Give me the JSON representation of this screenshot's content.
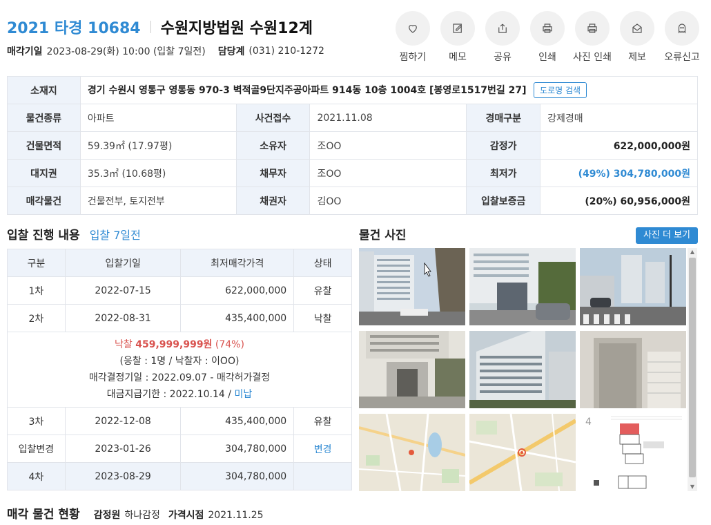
{
  "header": {
    "case_no": "2021 타경 10684",
    "court": "수원지방법원 수원12계",
    "sale_date_label": "매각기일",
    "sale_date": "2023-08-29(화) 10:00 (입찰 7일전)",
    "contact_label": "담당계",
    "contact": "(031) 210-1272"
  },
  "actions": [
    {
      "label": "찜하기",
      "icon": "heart-icon"
    },
    {
      "label": "메모",
      "icon": "memo-icon"
    },
    {
      "label": "공유",
      "icon": "share-icon"
    },
    {
      "label": "인쇄",
      "icon": "print-icon"
    },
    {
      "label": "사진 인쇄",
      "icon": "photo-print-icon"
    },
    {
      "label": "제보",
      "icon": "mail-icon"
    },
    {
      "label": "오류신고",
      "icon": "ghost-icon"
    }
  ],
  "info": {
    "location_label": "소재지",
    "location": "경기 수원시 영통구 영통동 970-3 벽적골9단지주공아파트 914동 10층 1004호 [봉영로1517번길 27]",
    "road_btn": "도로명 검색",
    "type_label": "물건종류",
    "type": "아파트",
    "received_label": "사건접수",
    "received": "2021.11.08",
    "auction_kind_label": "경매구분",
    "auction_kind": "강제경매",
    "area_label": "건물면적",
    "area": "59.39㎡ (17.97평)",
    "owner_label": "소유자",
    "owner": "조OO",
    "appraisal_label": "감정가",
    "appraisal": "622,000,000원",
    "land_label": "대지권",
    "land": "35.3㎡ (10.68평)",
    "debtor_label": "채무자",
    "debtor": "조OO",
    "min_price_label": "최저가",
    "min_price": "(49%) 304,780,000원",
    "items_label": "매각물건",
    "items": "건물전부, 토지전부",
    "creditor_label": "채권자",
    "creditor": "김OO",
    "deposit_label": "입찰보증금",
    "deposit": "(20%) 60,956,000원"
  },
  "bids": {
    "title": "입찰 진행 내용",
    "subtitle": "입찰 7일전",
    "headers": [
      "구분",
      "입찰기일",
      "최저매각가격",
      "상태"
    ],
    "rows": [
      {
        "round": "1차",
        "date": "2022-07-15",
        "price": "622,000,000",
        "status": "유찰"
      },
      {
        "round": "2차",
        "date": "2022-08-31",
        "price": "435,400,000",
        "status": "낙찰"
      }
    ],
    "detail": {
      "won_label": "낙찰",
      "won_amount": "459,999,999원",
      "won_pct": "(74%)",
      "line2": "(응찰 : 1명 / 낙찰자 : 이OO)",
      "line3": "매각결정기일 : 2022.09.07 - 매각허가결정",
      "line4": "대금지급기한 : 2022.10.14 /",
      "line4_status": "미납"
    },
    "rows2": [
      {
        "round": "3차",
        "date": "2022-12-08",
        "price": "435,400,000",
        "status": "유찰"
      },
      {
        "round": "입찰변경",
        "date": "2023-01-26",
        "price": "304,780,000",
        "status": "변경"
      },
      {
        "round": "4차",
        "date": "2023-08-29",
        "price": "304,780,000",
        "status": ""
      }
    ]
  },
  "photos": {
    "title": "물건 사진",
    "more_btn": "사진 더 보기",
    "floorplan_num": "4"
  },
  "footer": {
    "title": "매각 물건 현황",
    "appraiser_label": "감정원",
    "appraiser": "하나감정",
    "price_date_label": "가격시점",
    "price_date": "2021.11.25"
  }
}
